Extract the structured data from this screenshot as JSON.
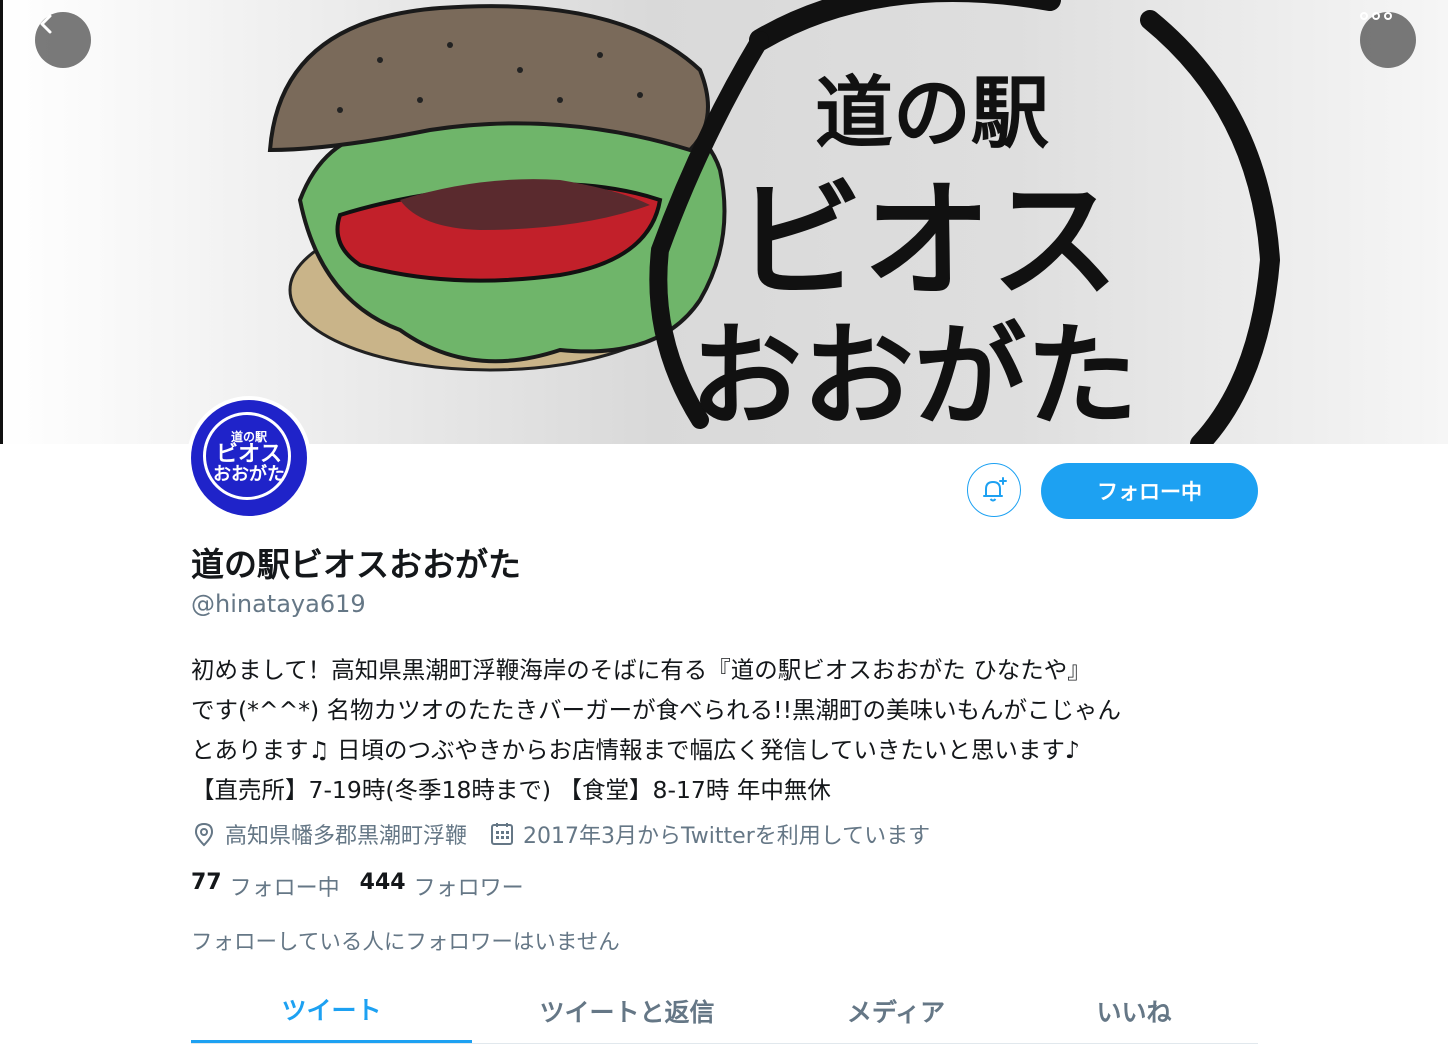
{
  "banner": {
    "logo_line1": "道の駅",
    "logo_line2": "ビオス",
    "logo_line3": "おおがた"
  },
  "header": {
    "back_icon": "chevron-left-icon",
    "more_icon": "more-horizontal-icon"
  },
  "avatar": {
    "line1": "道の駅",
    "line2": "ビオス",
    "line3": "おおがた",
    "color": "#1f23c9"
  },
  "actions": {
    "bell_icon": "bell-plus-icon",
    "follow_label": "フォロー中"
  },
  "profile": {
    "name": "道の駅ビオスおおがた",
    "handle": "@hinataya619",
    "bio_lines": [
      "初めまして！高知県黒潮町浮鞭海岸のそばに有る『道の駅ビオスおおがた ひなたや』",
      "です(*^^*) 名物カツオのたたきバーガーが食べられる!!黒潮町の美味いもんがこじゃん",
      "とあります♫ 日頃のつぶやきからお店情報まで幅広く発信していきたいと思います♪",
      "【直売所】7-19時(冬季18時まで) 【食堂】8-17時 年中無休"
    ],
    "location": "高知県幡多郡黒潮町浮鞭",
    "joined": "2017年3月からTwitterを利用しています",
    "location_icon": "location-pin-icon",
    "calendar_icon": "calendar-icon"
  },
  "stats": {
    "following_count": "77",
    "following_label": "フォロー中",
    "followers_count": "444",
    "followers_label": "フォロワー"
  },
  "mutual_note": "フォローしている人にフォロワーはいません",
  "tabs": [
    {
      "label": "ツイート",
      "active": true
    },
    {
      "label": "ツイートと返信",
      "active": false
    },
    {
      "label": "メディア",
      "active": false
    },
    {
      "label": "いいね",
      "active": false
    }
  ],
  "colors": {
    "accent": "#1da1f2",
    "text": "#14171a",
    "secondary": "#657786"
  }
}
